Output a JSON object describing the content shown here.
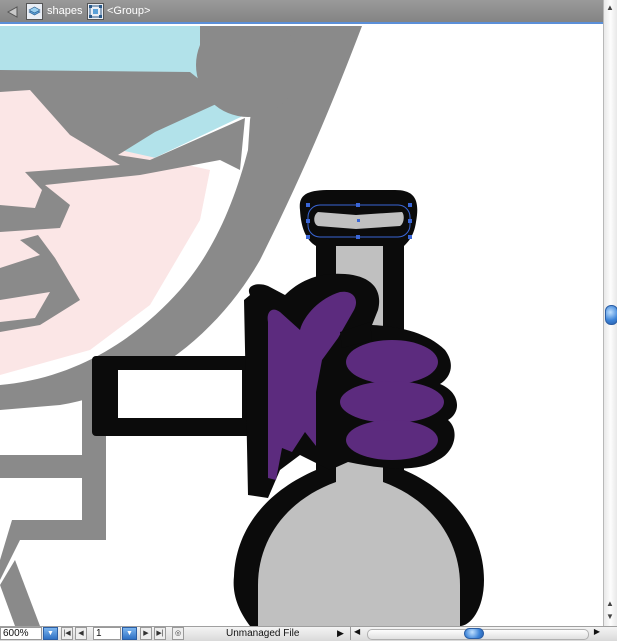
{
  "breadcrumb": {
    "layer_label": "shapes",
    "group_label": "<Group>"
  },
  "status_bar": {
    "zoom": "600%",
    "page": "1",
    "document_status": "Unmanaged File"
  },
  "colors": {
    "accent": "#5b8fd8",
    "artwork_gray": "#8a8a8a",
    "artwork_black": "#0b0b0b",
    "artwork_purple": "#5c2b7e",
    "artwork_light_gray": "#c0c0c0",
    "artwork_cyan": "#b2e2ea",
    "artwork_pink": "#fbe6e6",
    "selection_blue": "#3a66d6"
  },
  "icons": {
    "back": "back-arrow-icon",
    "layer": "layer-icon",
    "group": "group-icon"
  }
}
